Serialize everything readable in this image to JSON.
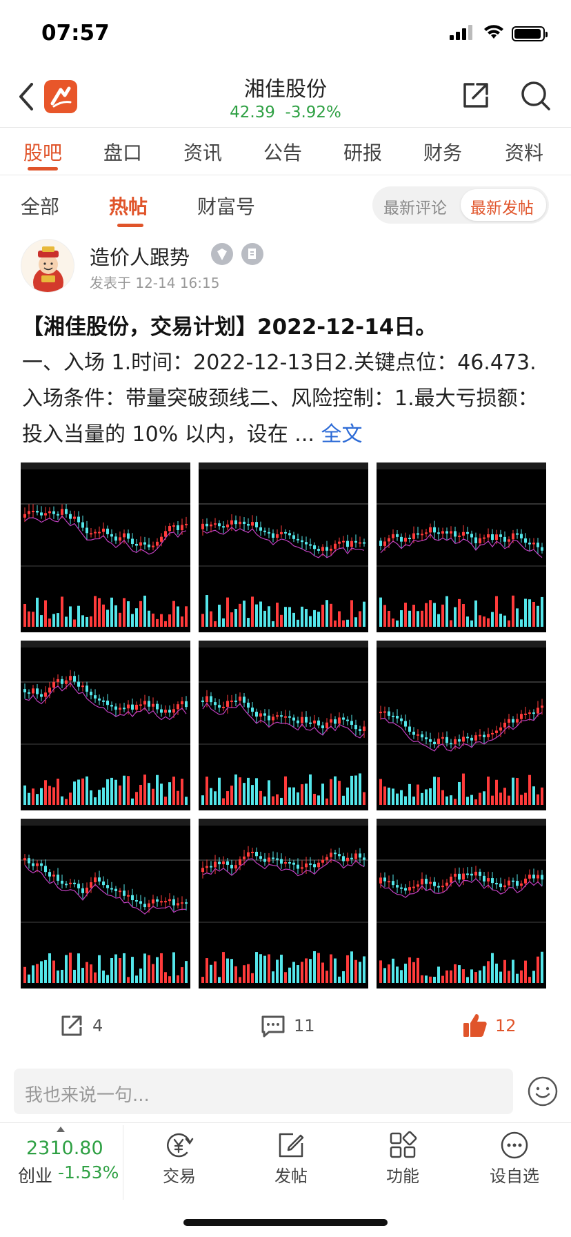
{
  "status_bar": {
    "time": "07:57"
  },
  "header": {
    "title": "湘佳股份",
    "price": "42.39",
    "change": "-3.92%",
    "back_icon": "chevron-left-icon",
    "share_icon": "share-icon",
    "search_icon": "search-icon"
  },
  "main_tabs": [
    "股吧",
    "盘口",
    "资讯",
    "公告",
    "研报",
    "财务",
    "资料"
  ],
  "sub_tabs": [
    "全部",
    "热帖",
    "财富号"
  ],
  "sort_toggle": {
    "latest_comment": "最新评论",
    "latest_post": "最新发帖"
  },
  "post": {
    "author": "造价人跟势",
    "time": "发表于 12-14 16:15",
    "title": "【湘佳股份，交易计划】2022-12-14日。",
    "body": "一、入场 1.时间：2022-12-13日2.关键点位：46.473.入场条件：带量突破颈线二、风险控制：1.最大亏损额：投入当量的 10% 以内，设在 ...",
    "more": "全文",
    "images": [
      "chart-image-1",
      "chart-image-2",
      "chart-image-3",
      "chart-image-4",
      "chart-image-5",
      "chart-image-6",
      "chart-image-7",
      "chart-image-8",
      "chart-image-9"
    ],
    "shares": "4",
    "comments": "11",
    "likes": "12"
  },
  "comment_input": {
    "placeholder": "我也来说一句..."
  },
  "bottom_bar": {
    "index_value": "2310.80",
    "index_name": "创业",
    "index_change": "-1.53%",
    "items": [
      "交易",
      "发帖",
      "功能",
      "设自选"
    ]
  },
  "colors": {
    "accent": "#e0542a",
    "down": "#2ea043",
    "link": "#2d6bd6"
  }
}
